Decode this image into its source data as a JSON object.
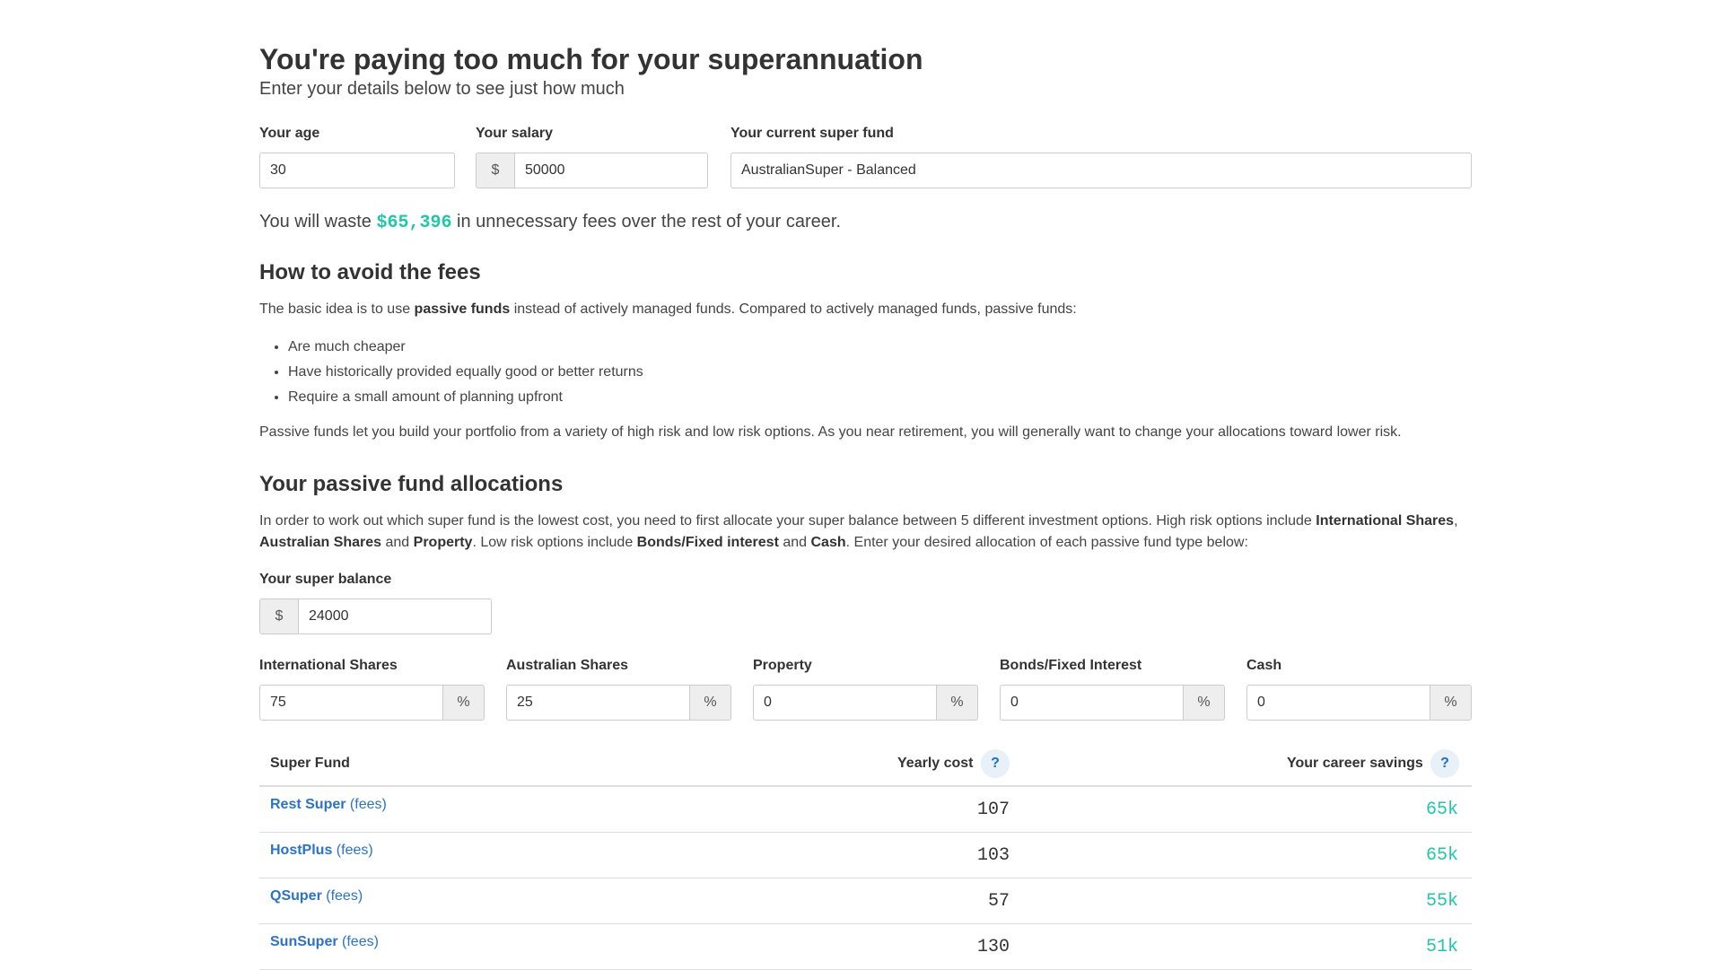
{
  "header": {
    "title": "You're paying too much for your superannuation",
    "subtitle": "Enter your details below to see just how much"
  },
  "form": {
    "age_label": "Your age",
    "age_value": "30",
    "salary_label": "Your salary",
    "salary_prefix": "$",
    "salary_value": "50000",
    "fund_label": "Your current super fund",
    "fund_value": "AustralianSuper - Balanced"
  },
  "waste": {
    "prefix": "You will waste ",
    "amount": "$65,396",
    "suffix": " in unnecessary fees over the rest of your career."
  },
  "avoid": {
    "heading": "How to avoid the fees",
    "intro_before": "The basic idea is to use ",
    "intro_bold": "passive funds",
    "intro_after": " instead of actively managed funds. Compared to actively managed funds, passive funds:",
    "bullets": [
      "Are much cheaper",
      "Have historically provided equally good or better returns",
      "Require a small amount of planning upfront"
    ],
    "outro": "Passive funds let you build your portfolio from a variety of high risk and low risk options. As you near retirement, you will generally want to change your allocations toward lower risk."
  },
  "allocations": {
    "heading": "Your passive fund allocations",
    "text_1": "In order to work out which super fund is the lowest cost, you need to first allocate your super balance between 5 different investment options. High risk options include ",
    "bold_1": "International Shares",
    "text_2": ", ",
    "bold_2": "Australian Shares",
    "text_3": " and ",
    "bold_3": "Property",
    "text_4": ". Low risk options include ",
    "bold_4": "Bonds/Fixed interest",
    "text_5": " and ",
    "bold_5": "Cash",
    "text_6": ". Enter your desired allocation of each passive fund type below:",
    "balance_label": "Your super balance",
    "balance_prefix": "$",
    "balance_value": "24000",
    "percent_suffix": "%",
    "options": [
      {
        "label": "International Shares",
        "value": "75"
      },
      {
        "label": "Australian Shares",
        "value": "25"
      },
      {
        "label": "Property",
        "value": "0"
      },
      {
        "label": "Bonds/Fixed Interest",
        "value": "0"
      },
      {
        "label": "Cash",
        "value": "0"
      }
    ]
  },
  "table": {
    "col_fund": "Super Fund",
    "col_yearly": "Yearly cost",
    "col_savings": "Your career savings",
    "help_glyph": "?",
    "fees_label": "(fees)",
    "rows": [
      {
        "fund": "Rest Super",
        "yearly": "107",
        "savings": "65k"
      },
      {
        "fund": "HostPlus",
        "yearly": "103",
        "savings": "65k"
      },
      {
        "fund": "QSuper",
        "yearly": "57",
        "savings": "55k"
      },
      {
        "fund": "SunSuper",
        "yearly": "130",
        "savings": "51k"
      }
    ]
  },
  "colors": {
    "accent_green": "#1fc9a8",
    "link_blue": "#2a73c8"
  }
}
